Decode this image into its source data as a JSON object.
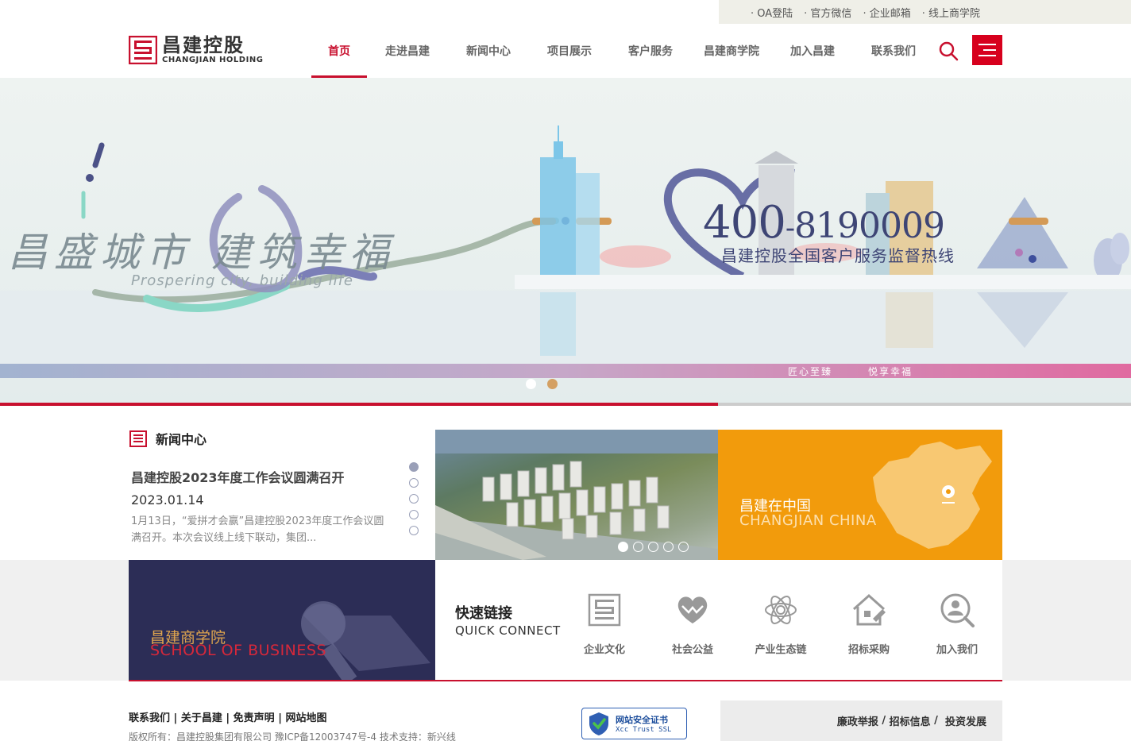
{
  "utility_links": [
    "· OA登陆",
    "· 官方微信",
    "· 企业邮箱",
    "· 线上商学院"
  ],
  "logo": {
    "cn": "昌建控股",
    "en": "CHANGJIAN HOLDING"
  },
  "nav": [
    {
      "label": "首页",
      "active": true
    },
    {
      "label": "走进昌建",
      "active": false
    },
    {
      "label": "新闻中心",
      "active": false
    },
    {
      "label": "项目展示",
      "active": false
    },
    {
      "label": "客户服务",
      "active": false
    },
    {
      "label": "昌建商学院",
      "active": false
    },
    {
      "label": "加入昌建",
      "active": false
    },
    {
      "label": "联系我们",
      "active": false
    }
  ],
  "banner": {
    "slogan_cn": "昌盛城市 建筑幸福",
    "slogan_en": "Prospering city, building life",
    "hotline_prefix": "400",
    "hotline_sep": "-",
    "hotline_number": "8190009",
    "hotline_caption": "昌建控股全国客户服务监督热线",
    "stripe_left": "匠心至臻",
    "stripe_right": "悦享幸福",
    "slides": 2,
    "active_slide": 1,
    "progress_fraction": 0.635
  },
  "news": {
    "section_title": "新闻中心",
    "headline": "昌建控股2023年度工作会议圆满召开",
    "date": "2023.01.14",
    "summary": "1月13日，“爱拼才会赢”昌建控股2023年度工作会议圆满召开。本次会议线上线下联动，集团...",
    "pages": 5,
    "active_page": 0
  },
  "project_photo": {
    "pages": 5,
    "active_page": 0
  },
  "china_tile": {
    "cn": "昌建在中国",
    "en": "CHANGJIAN CHINA"
  },
  "school_tile": {
    "cn": "昌建商学院",
    "en": "SCHOOL OF BUSINESS"
  },
  "quick": {
    "title": "快速链接",
    "subtitle": "QUICK CONNECT",
    "items": [
      {
        "label": "企业文化",
        "icon": "culture-icon"
      },
      {
        "label": "社会公益",
        "icon": "heart-icon"
      },
      {
        "label": "产业生态链",
        "icon": "atom-icon"
      },
      {
        "label": "招标采购",
        "icon": "house-pen-icon"
      },
      {
        "label": "加入我们",
        "icon": "user-search-icon"
      }
    ]
  },
  "footer": {
    "links": [
      "联系我们",
      "关于昌建",
      "免责声明",
      "网站地图"
    ],
    "copyright": "版权所有：昌建控股集团有限公司   豫ICP备12003747号-4    技术支持：新兴线",
    "ssl_title": "网站安全证书",
    "ssl_sub": "Xcc Trust SSL",
    "right_links": [
      "廉政举报",
      "招标信息",
      "投资发展"
    ]
  },
  "colors": {
    "brand_red": "#c8102e",
    "orange": "#f29b0c",
    "navy": "#2c2d56"
  }
}
